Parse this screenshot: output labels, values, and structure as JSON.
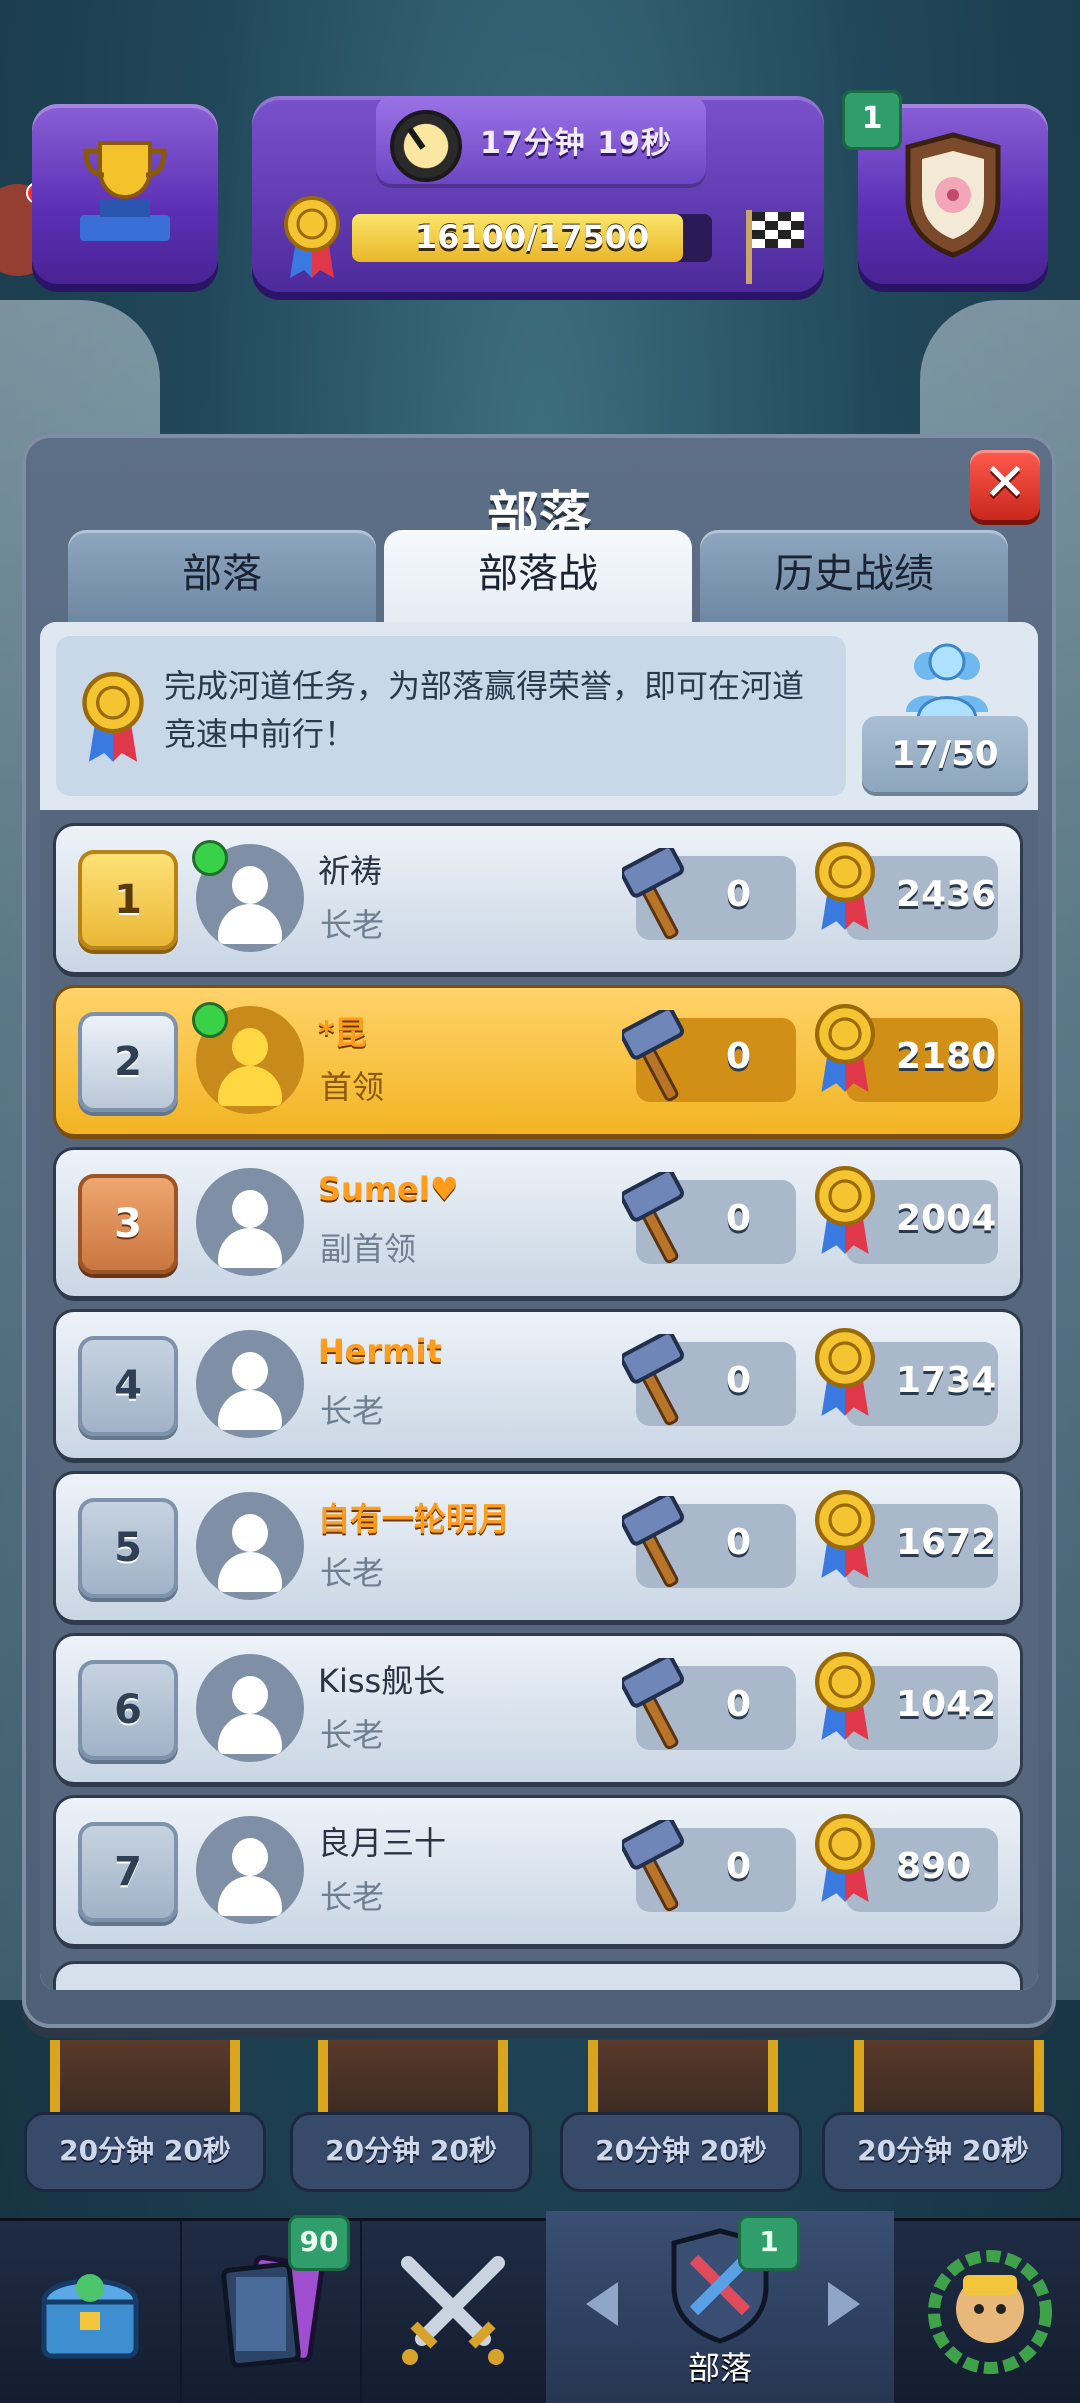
{
  "header": {
    "timer": "17分钟 19秒",
    "progress_text": "16100/17500",
    "progress_fraction": 0.92,
    "clan_badge_count": "1"
  },
  "modal": {
    "title": "部落",
    "close_label": "✕",
    "tabs": [
      {
        "label": "部落",
        "active": false
      },
      {
        "label": "部落战",
        "active": true
      },
      {
        "label": "历史战绩",
        "active": false
      }
    ],
    "info_text": "完成河道任务，为部落赢得荣誉，即可在河道竞速中前行！",
    "members": "17/50"
  },
  "members": [
    {
      "rank": "1",
      "name": "祈祷",
      "role": "长老",
      "hammer": "0",
      "fame": "2436",
      "online": true,
      "highlight": false,
      "name_style": "normal",
      "rank_style": "gold"
    },
    {
      "rank": "2",
      "name": "*昆",
      "role": "首领",
      "hammer": "0",
      "fame": "2180",
      "online": true,
      "highlight": true,
      "name_style": "orange",
      "rank_style": "silver"
    },
    {
      "rank": "3",
      "name": "Sumel♥",
      "role": "副首领",
      "hammer": "0",
      "fame": "2004",
      "online": false,
      "highlight": false,
      "name_style": "orange",
      "rank_style": "bronze"
    },
    {
      "rank": "4",
      "name": "Hermit",
      "role": "长老",
      "hammer": "0",
      "fame": "1734",
      "online": false,
      "highlight": false,
      "name_style": "orange",
      "rank_style": "plain"
    },
    {
      "rank": "5",
      "name": "自有一轮明月",
      "role": "长老",
      "hammer": "0",
      "fame": "1672",
      "online": false,
      "highlight": false,
      "name_style": "orange",
      "rank_style": "plain"
    },
    {
      "rank": "6",
      "name": "Kiss舰长",
      "role": "长老",
      "hammer": "0",
      "fame": "1042",
      "online": false,
      "highlight": false,
      "name_style": "normal",
      "rank_style": "plain"
    },
    {
      "rank": "7",
      "name": "良月三十",
      "role": "长老",
      "hammer": "0",
      "fame": "890",
      "online": false,
      "highlight": false,
      "name_style": "normal",
      "rank_style": "plain"
    }
  ],
  "chest_timers": [
    "20分钟 20秒",
    "20分钟 20秒",
    "20分钟 20秒",
    "20分钟 20秒"
  ],
  "nav": {
    "cards_badge": "90",
    "clan_badge": "1",
    "clan_label": "部落"
  },
  "colors": {
    "highlight_row": "#f2b424",
    "accent_purple": "#5b2fb4",
    "close_red": "#c9281d",
    "online_green": "#39d148"
  }
}
